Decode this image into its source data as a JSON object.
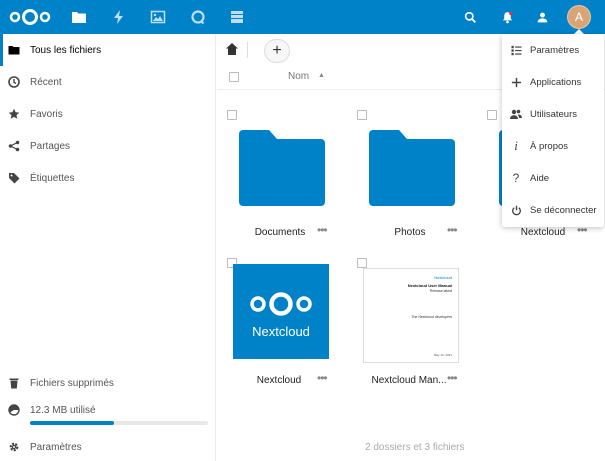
{
  "header": {
    "avatar_letter": "A",
    "apps": [
      "files-icon",
      "activity-icon",
      "gallery-icon",
      "talk-icon",
      "deck-icon"
    ],
    "accent": "#0082c9"
  },
  "sidebar": {
    "items": [
      {
        "label": "Tous les fichiers",
        "icon": "folder-icon"
      },
      {
        "label": "Récent",
        "icon": "clock-icon"
      },
      {
        "label": "Favoris",
        "icon": "star-icon"
      },
      {
        "label": "Partages",
        "icon": "share-icon"
      },
      {
        "label": "Étiquettes",
        "icon": "tag-icon"
      }
    ],
    "trash_label": "Fichiers supprimés",
    "quota_label": "12.3 MB utilisé",
    "quota_fraction": 0.47,
    "settings_label": "Paramètres"
  },
  "controls": {
    "add_label": "+",
    "sort_label": "Nom",
    "sort_arrow": "▲"
  },
  "files": [
    {
      "name": "Documents",
      "type": "folder"
    },
    {
      "name": "Photos",
      "type": "folder"
    },
    {
      "name": "Nextcloud",
      "type": "folder"
    },
    {
      "name": "Nextcloud",
      "type": "image"
    },
    {
      "name": "Nextcloud Man...",
      "type": "pdf"
    }
  ],
  "thumbs": {
    "nc_brand": "Nextcloud",
    "doc_brand": "Nextcloud",
    "doc_title": "Nextcloud User Manual",
    "doc_sub": "Release latest",
    "doc_dev": "The Nextcloud developers",
    "doc_date": "May 13, 2021"
  },
  "more_glyph": "•••",
  "summary": "2 dossiers et 3 fichiers",
  "menu": {
    "items": [
      {
        "label": "Paramètres",
        "icon": "settings-list-icon"
      },
      {
        "label": "Applications",
        "icon": "plus-icon"
      },
      {
        "label": "Utilisateurs",
        "icon": "users-icon"
      },
      {
        "label": "À propos",
        "icon": "info-icon"
      },
      {
        "label": "Aide",
        "icon": "help-icon"
      },
      {
        "label": "Se déconnecter",
        "icon": "power-icon"
      }
    ]
  }
}
